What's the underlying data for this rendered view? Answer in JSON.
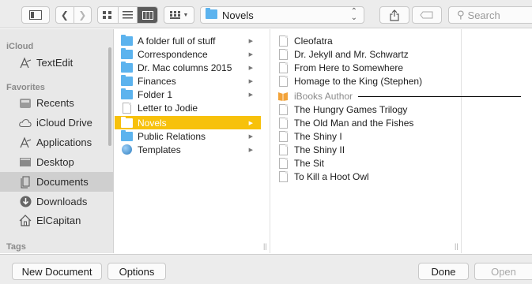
{
  "toolbar": {
    "location_label": "Novels",
    "search_placeholder": "Search"
  },
  "sidebar": {
    "sections": [
      {
        "header": "iCloud",
        "items": [
          {
            "label": "TextEdit",
            "icon": "textedit-icon"
          }
        ]
      },
      {
        "header": "Favorites",
        "items": [
          {
            "label": "Recents",
            "icon": "recents-icon"
          },
          {
            "label": "iCloud Drive",
            "icon": "cloud-icon"
          },
          {
            "label": "Applications",
            "icon": "applications-icon"
          },
          {
            "label": "Desktop",
            "icon": "desktop-icon"
          },
          {
            "label": "Documents",
            "icon": "documents-icon",
            "selected": true
          },
          {
            "label": "Downloads",
            "icon": "downloads-icon"
          },
          {
            "label": "ElCapitan",
            "icon": "home-icon"
          }
        ]
      },
      {
        "header": "Tags",
        "items": []
      }
    ]
  },
  "column1": {
    "items": [
      {
        "label": "A folder full of stuff",
        "type": "folder",
        "has_children": true
      },
      {
        "label": "Correspondence",
        "type": "folder",
        "has_children": true
      },
      {
        "label": "Dr. Mac columns 2015",
        "type": "folder",
        "has_children": true
      },
      {
        "label": "Finances",
        "type": "folder",
        "has_children": true
      },
      {
        "label": "Folder 1",
        "type": "folder",
        "has_children": true
      },
      {
        "label": "Letter to Jodie",
        "type": "document",
        "has_children": false
      },
      {
        "label": "Novels",
        "type": "folder",
        "has_children": true,
        "selected": true
      },
      {
        "label": "Public Relations",
        "type": "folder",
        "has_children": true
      },
      {
        "label": "Templates",
        "type": "special",
        "has_children": true
      }
    ]
  },
  "column2": {
    "items": [
      {
        "label": "Cleofatra",
        "dim": false
      },
      {
        "label": "Dr. Jekyll and Mr. Schwartz",
        "dim": false
      },
      {
        "label": "From Here to Somewhere",
        "dim": false
      },
      {
        "label": "Homage to the King (Stephen)",
        "dim": false
      },
      {
        "label": "iBooks Author",
        "dim": true
      },
      {
        "label": "The Hungry Games Trilogy",
        "dim": false
      },
      {
        "label": "The Old Man and the Fishes",
        "dim": false
      },
      {
        "label": "The Shiny I",
        "dim": false
      },
      {
        "label": "The Shiny II",
        "dim": false
      },
      {
        "label": "The Sit",
        "dim": false
      },
      {
        "label": "To Kill a Hoot Owl",
        "dim": false
      }
    ]
  },
  "bottom": {
    "new_document": "New Document",
    "options": "Options",
    "done": "Done",
    "open": "Open"
  },
  "colors": {
    "selection": "#f7c10b",
    "folder": "#5cb3ee",
    "sidebar_bg": "#e8e8e8"
  }
}
